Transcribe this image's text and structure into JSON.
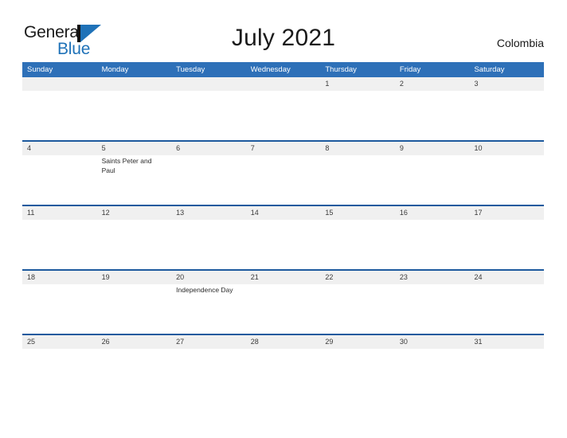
{
  "brand": {
    "name_part1": "General",
    "name_part2": "Blue"
  },
  "header": {
    "title": "July 2021",
    "country": "Colombia"
  },
  "colors": {
    "header_blue": "#2e70b8",
    "row_rule_blue": "#1d5a9e",
    "date_band_gray": "#f0f0f0",
    "logo_blue": "#1f72b8",
    "text_dark": "#1a1a1a"
  },
  "calendar": {
    "weekdays": [
      "Sunday",
      "Monday",
      "Tuesday",
      "Wednesday",
      "Thursday",
      "Friday",
      "Saturday"
    ],
    "weeks": [
      {
        "days": [
          {
            "num": "",
            "event": ""
          },
          {
            "num": "",
            "event": ""
          },
          {
            "num": "",
            "event": ""
          },
          {
            "num": "",
            "event": ""
          },
          {
            "num": "1",
            "event": ""
          },
          {
            "num": "2",
            "event": ""
          },
          {
            "num": "3",
            "event": ""
          }
        ]
      },
      {
        "days": [
          {
            "num": "4",
            "event": ""
          },
          {
            "num": "5",
            "event": "Saints Peter and Paul"
          },
          {
            "num": "6",
            "event": ""
          },
          {
            "num": "7",
            "event": ""
          },
          {
            "num": "8",
            "event": ""
          },
          {
            "num": "9",
            "event": ""
          },
          {
            "num": "10",
            "event": ""
          }
        ]
      },
      {
        "days": [
          {
            "num": "11",
            "event": ""
          },
          {
            "num": "12",
            "event": ""
          },
          {
            "num": "13",
            "event": ""
          },
          {
            "num": "14",
            "event": ""
          },
          {
            "num": "15",
            "event": ""
          },
          {
            "num": "16",
            "event": ""
          },
          {
            "num": "17",
            "event": ""
          }
        ]
      },
      {
        "days": [
          {
            "num": "18",
            "event": ""
          },
          {
            "num": "19",
            "event": ""
          },
          {
            "num": "20",
            "event": "Independence Day"
          },
          {
            "num": "21",
            "event": ""
          },
          {
            "num": "22",
            "event": ""
          },
          {
            "num": "23",
            "event": ""
          },
          {
            "num": "24",
            "event": ""
          }
        ]
      },
      {
        "days": [
          {
            "num": "25",
            "event": ""
          },
          {
            "num": "26",
            "event": ""
          },
          {
            "num": "27",
            "event": ""
          },
          {
            "num": "28",
            "event": ""
          },
          {
            "num": "29",
            "event": ""
          },
          {
            "num": "30",
            "event": ""
          },
          {
            "num": "31",
            "event": ""
          }
        ]
      }
    ]
  }
}
